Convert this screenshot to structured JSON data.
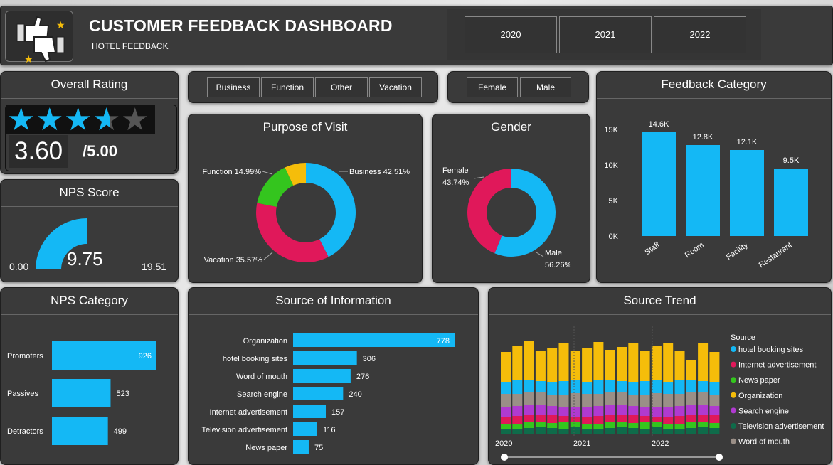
{
  "header": {
    "title": "CUSTOMER FEEDBACK DASHBOARD",
    "subtitle": "HOTEL FEEDBACK",
    "years": [
      "2020",
      "2021",
      "2022"
    ]
  },
  "overall_rating": {
    "title": "Overall Rating",
    "value": "3.60",
    "max": "/5.00",
    "stars_fraction": 0.72
  },
  "nps_score": {
    "title": "NPS Score",
    "min": "0.00",
    "value": "9.75",
    "max": "19.51"
  },
  "purpose_slicer": [
    "Business",
    "Function",
    "Other",
    "Vacation"
  ],
  "gender_slicer": [
    "Female",
    "Male"
  ],
  "nps_category": {
    "title": "NPS Category"
  },
  "purpose_of_visit": {
    "title": "Purpose of Visit"
  },
  "gender": {
    "title": "Gender"
  },
  "feedback_category": {
    "title": "Feedback Category"
  },
  "source_of_information": {
    "title": "Source of Information"
  },
  "source_trend": {
    "title": "Source Trend",
    "legend_title": "Source"
  },
  "colors": {
    "accent": "#14b8f5",
    "pink": "#e0185a",
    "green": "#34c51e",
    "yellow": "#f5bd0a",
    "purple": "#b03ad0",
    "darkgreen": "#0f6b4a",
    "grey": "#9a8f87",
    "panel": "#3a3a3a"
  },
  "chart_data": [
    {
      "type": "pie",
      "name": "Purpose of Visit",
      "labels": [
        "Business",
        "Vacation",
        "Function",
        "Other"
      ],
      "values": [
        42.51,
        35.57,
        14.99,
        6.93
      ],
      "display_labels": [
        "Business 42.51%",
        "Vacation 35.57%",
        "Function 14.99%",
        ""
      ],
      "colors": [
        "#14b8f5",
        "#e0185a",
        "#34c51e",
        "#f5bd0a"
      ]
    },
    {
      "type": "pie",
      "name": "Gender",
      "labels": [
        "Male",
        "Female"
      ],
      "values": [
        56.26,
        43.74
      ],
      "display_labels": [
        [
          "Male",
          "56.26%"
        ],
        [
          "Female",
          "43.74%"
        ]
      ],
      "colors": [
        "#14b8f5",
        "#e0185a"
      ]
    },
    {
      "type": "bar",
      "name": "Feedback Category",
      "categories": [
        "Staff",
        "Room",
        "Facility",
        "Restaurant"
      ],
      "values": [
        14600,
        12800,
        12100,
        9500
      ],
      "data_labels": [
        "14.6K",
        "12.8K",
        "12.1K",
        "9.5K"
      ],
      "yticks": [
        "0K",
        "5K",
        "10K",
        "15K"
      ],
      "ylim": [
        0,
        15000
      ]
    },
    {
      "type": "bar",
      "orientation": "horizontal",
      "name": "Source of Information",
      "categories": [
        "Organization",
        "hotel booking sites",
        "Word of mouth",
        "Search engine",
        "Internet advertisement",
        "Television advertisement",
        "News paper"
      ],
      "values": [
        778,
        306,
        276,
        240,
        157,
        116,
        75
      ]
    },
    {
      "type": "bar",
      "orientation": "horizontal",
      "name": "NPS Category",
      "categories": [
        "Promoters",
        "Passives",
        "Detractors"
      ],
      "values": [
        926,
        523,
        499
      ]
    },
    {
      "type": "area",
      "name": "Source Trend",
      "x_ticks": [
        "2020",
        "2021",
        "2022"
      ],
      "series": [
        {
          "name": "hotel booking sites",
          "color": "#14b8f5"
        },
        {
          "name": "Internet advertisement",
          "color": "#e0185a"
        },
        {
          "name": "News paper",
          "color": "#34c51e"
        },
        {
          "name": "Organization",
          "color": "#f5bd0a"
        },
        {
          "name": "Search engine",
          "color": "#b03ad0"
        },
        {
          "name": "Television advertisement",
          "color": "#0f6b4a"
        },
        {
          "name": "Word of mouth",
          "color": "#9a8f87"
        }
      ]
    }
  ]
}
